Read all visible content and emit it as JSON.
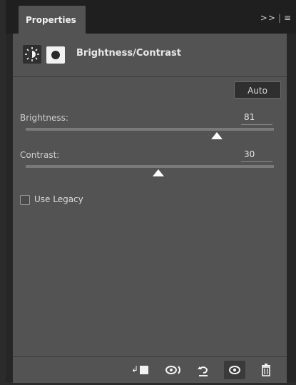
{
  "tab": {
    "label": "Properties"
  },
  "panel_menu": {
    "collapse": ">>",
    "separator": "|",
    "menu": "≡"
  },
  "header": {
    "title": "Brightness/Contrast",
    "adjustment_icon": "brightness-contrast-icon",
    "mask_icon": "layer-mask-icon"
  },
  "controls": {
    "auto_label": "Auto",
    "brightness": {
      "label": "Brightness:",
      "value": "81",
      "min": -150,
      "max": 150,
      "current": 81
    },
    "contrast": {
      "label": "Contrast:",
      "value": "30",
      "min": -50,
      "max": 100,
      "current": 30
    },
    "legacy": {
      "label": "Use Legacy",
      "checked": false
    }
  },
  "toolbar": {
    "icons": [
      "clip-to-layer-icon",
      "view-previous-state-icon",
      "reset-icon",
      "visibility-eye-icon",
      "trash-icon"
    ]
  },
  "colors": {
    "panel_bg": "#535353",
    "chrome_bg": "#1f1f1f",
    "thumb": "#ffffff"
  }
}
